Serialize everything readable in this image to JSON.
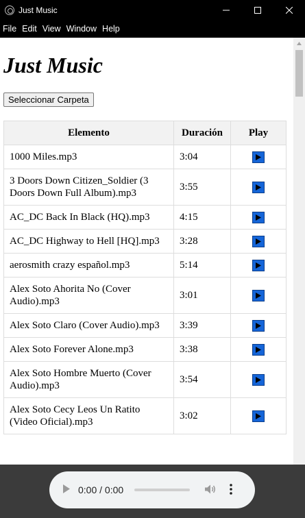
{
  "window": {
    "title": "Just Music"
  },
  "menu": [
    "File",
    "Edit",
    "View",
    "Window",
    "Help"
  ],
  "page": {
    "heading": "Just Music",
    "folder_button": "Seleccionar Carpeta"
  },
  "table": {
    "headers": [
      "Elemento",
      "Duración",
      "Play"
    ],
    "rows": [
      {
        "name": "1000 Miles.mp3",
        "duration": "3:04"
      },
      {
        "name": "3 Doors Down Citizen_Soldier (3 Doors Down Full Album).mp3",
        "duration": "3:55"
      },
      {
        "name": "AC_DC Back In Black (HQ).mp3",
        "duration": "4:15"
      },
      {
        "name": "AC_DC Highway to Hell [HQ].mp3",
        "duration": "3:28"
      },
      {
        "name": "aerosmith crazy español.mp3",
        "duration": "5:14"
      },
      {
        "name": "Alex Soto Ahorita No (Cover Audio).mp3",
        "duration": "3:01"
      },
      {
        "name": "Alex Soto Claro (Cover Audio).mp3",
        "duration": "3:39"
      },
      {
        "name": "Alex Soto Forever Alone.mp3",
        "duration": "3:38"
      },
      {
        "name": "Alex Soto Hombre Muerto (Cover Audio).mp3",
        "duration": "3:54"
      },
      {
        "name": "Alex Soto Cecy Leos Un Ratito (Video Oficial).mp3",
        "duration": "3:02"
      }
    ]
  },
  "player": {
    "time": "0:00 / 0:00",
    "progress": 0
  },
  "colors": {
    "accent": "#1565d8",
    "titlebar": "#000000",
    "player_bg": "#3b3b3b"
  },
  "icons": [
    "app-icon",
    "minimize-icon",
    "maximize-icon",
    "close-icon",
    "play-icon",
    "volume-icon",
    "more-options-icon",
    "scroll-up-arrow-icon"
  ]
}
